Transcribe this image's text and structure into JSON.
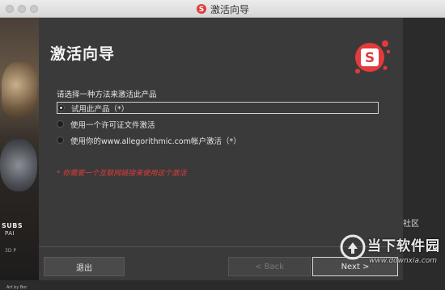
{
  "window": {
    "title": "激活向导"
  },
  "background": {
    "text_1": "SUBS",
    "text_2": "PAI",
    "text_3": "3D P",
    "text_4": "Art by Bor",
    "right_label": "社区"
  },
  "wizard": {
    "heading": "激活向导",
    "prompt": "请选择一种方法来激活此产品",
    "options": [
      {
        "label": "试用此产品（*）",
        "selected": true
      },
      {
        "label": "使用一个许可证文件激活",
        "selected": false
      },
      {
        "label": "使用你的www.allegorithmic.com帐户激活（*）",
        "selected": false
      }
    ],
    "warning": "* 你需要一个互联网链接来使用这个激活",
    "buttons": {
      "exit": "退出",
      "back": "< Back",
      "next": "Next >"
    },
    "colors": {
      "accent": "#e23b3b",
      "dialog_bg": "#3a3a3a"
    }
  },
  "watermark": {
    "text": "当下软件园",
    "url": "www.downxia.com"
  }
}
